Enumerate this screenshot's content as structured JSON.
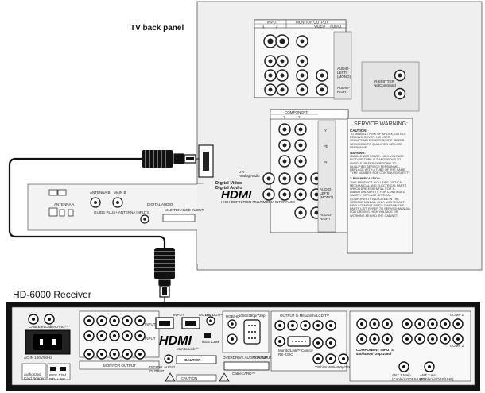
{
  "tv_panel": {
    "title": "TV back panel",
    "input_header": "INPUT",
    "monitor_output_header": "MONITOR OUTPUT",
    "input_cols": [
      "1",
      "2"
    ],
    "monitor_cols": [
      "VIDEO",
      "AUDIO"
    ],
    "audio_left": "AUDIO-\nLEFT/\n(MONO)",
    "audio_right": "AUDIO-\nRIGHT",
    "netcommand": "IR-EMITTER\nNetCommand",
    "component_header": "COMPONENT",
    "component_cols": [
      "1",
      "2"
    ],
    "comp_labels": [
      "Y",
      "Pb",
      "Pr",
      "AUDIO-\nLEFT/\n(MONO)",
      "AUDIO-\nRIGHT"
    ],
    "dvi_analog_audio": "DVI\nAnalog Audio",
    "digital_video_audio": "Digital Video\nDigital Audio",
    "hdmi_brand": "HDMI",
    "hdmi_tagline": "HIGH-DEFINITION MULTIMEDIA INTERFACE",
    "service_warning_title": "SERVICE WARNING:",
    "service_caution_head": "CAUTION:",
    "service_caution_text": "TO MINIMIZE RISK OF SHOCK, DO NOT REMOVE COVER. NO USER-SERVICEABLE PARTS INSIDE. REFER SERVICING TO QUALIFIED SERVICE PERSONNEL.",
    "service_warning_head": "WARNING:",
    "service_warning_text": "HANDLE WITH CARE. HIGH VOLTAGE PICTURE TUBE IS DANGEROUS TO HANDLE. REFER SERVICING TO QUALIFIED SERVICE PERSONNEL. REPLACE WITH A TUBE OF THE SAME TYPE NUMBER FOR CONTINUED SAFETY.",
    "xray_head": "X-RAY PRECAUTION:",
    "xray_text": "THIS PRODUCT INCLUDES CRITICAL MECHANICAL AND ELECTRICAL PARTS WHICH ARE ESSENTIAL FOR X-RADIATION SAFETY. FOR CONTINUED SAFETY REPLACE CRITICAL COMPONENTS INDICATED IN THE SERVICE MANUAL ONLY WITH EXACT REPLACEMENT PARTS GIVEN IN THE PARTS LIST. REFER TO SERVICE MANUAL FOR DRIVING HIGH VOLTAGE OR WORKING BEHIND THE CABINET.",
    "lower_labels": [
      "ANTENNA A",
      "ANTENNA B",
      "MAIN B",
      "DIGITAL AUDIO",
      "MAINTENANCE IN/OUT"
    ],
    "lower_caption": "GUIDE PLUS+ ANTENNA INPUTS"
  },
  "receiver": {
    "title": "HD-6000 Receiver",
    "hdmi_brand": "HDMI",
    "labels": {
      "cable_in": "CABLE IN",
      "cablecard": "CableCARD™",
      "ac_in": "AC IN 120V/60Hz",
      "authorized": "Authorized\nCard Reader",
      "ieee": "IEEE 1394\nDTV LINK",
      "monitor_output": "MONITOR OUTPUT",
      "audio": "AUDIO",
      "input": "INPUT",
      "output": "OUTPUT",
      "dvi_output": "DVI OUTPUT",
      "ieee_mini": "IEEE 1394",
      "monitorlink": "MonitorLink™",
      "digital_audio_output": "DIGITAL AUDIO\nOUTPUT",
      "caution": "CAUTION",
      "optical": "OPTICAL",
      "rgb": "RGB/HD",
      "video_1080": "1080i/480p/720p",
      "overdrive": "OVERDRIVE AUDIO INPUT",
      "vga_input": "VGA INPUT",
      "output_to_lcd": "OUTPUT to Mitsubishi LCD TV",
      "netcommand": "MonitorLink™ Control\nRS-232C",
      "component_inputs": "COMPONENT INPUTS\n480i/480p/720p/1080i",
      "component_out": "COMPONENT OUTPUT",
      "comp1": "COMP 1",
      "comp2": "COMP 2",
      "ant1": "ANT 1 Main\n(Cable/Air/DBS/UHF)",
      "ant2": "ANT 2 Aux\n(Cable/Air/DBS/UHF)",
      "rf": "RF/ANT",
      "ypbpr": "Y/Pb/Pr 480i/480p/720p/1080i"
    }
  }
}
